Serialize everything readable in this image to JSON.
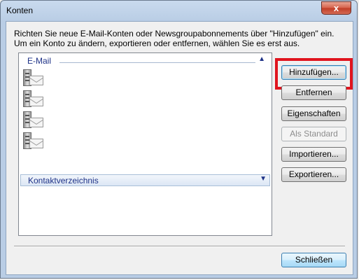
{
  "window": {
    "title": "Konten",
    "close_glyph": "x"
  },
  "intro": {
    "line1": "Richten Sie neue E-Mail-Konten oder Newsgroupabonnements über \"Hinzufügen\" ein.",
    "line2": "Um ein Konto zu ändern, exportieren oder entfernen, wählen Sie es erst aus."
  },
  "list": {
    "email_group": "E-Mail",
    "email_accounts": [
      {
        "icon": "mail-server-icon"
      },
      {
        "icon": "mail-server-icon"
      },
      {
        "icon": "mail-server-icon"
      },
      {
        "icon": "mail-server-icon"
      }
    ],
    "directory_group": "Kontaktverzeichnis"
  },
  "buttons": {
    "add": "Hinzufügen...",
    "remove": "Entfernen",
    "properties": "Eigenschaften",
    "set_default": "Als Standard",
    "import": "Importieren...",
    "export": "Exportieren...",
    "close": "Schließen"
  },
  "colors": {
    "highlight": "#e0141e",
    "group_text": "#1e3287"
  }
}
